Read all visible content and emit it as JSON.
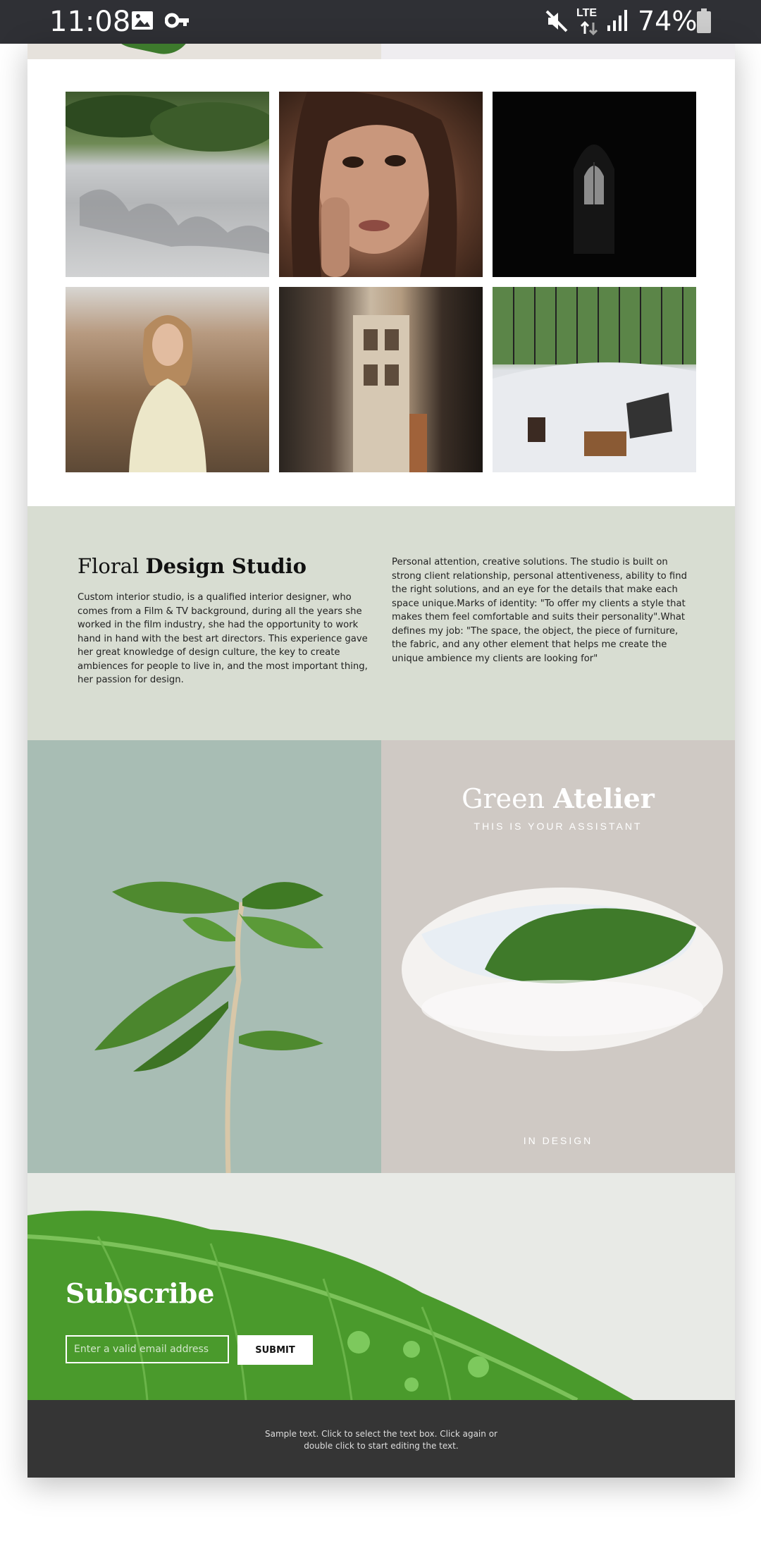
{
  "status_bar": {
    "time": "11:08",
    "network": "LTE",
    "battery": "74%",
    "icons": [
      "image-icon",
      "vpn-key-icon",
      "mute-icon",
      "signal-icon",
      "battery-icon"
    ]
  },
  "gallery": {
    "images": [
      "tree-shadow-photo",
      "woman-face-photo",
      "dark-arch-window-photo",
      "woman-in-field-photo",
      "narrow-street-photo",
      "bed-laptop-photo"
    ]
  },
  "about": {
    "title_light": "Floral ",
    "title_bold": "Design Studio",
    "left_text": "Custom interior studio, is a qualified interior designer, who comes from a Film & TV background, during all the years she worked in the film industry, she had the opportunity to work hand in hand with the best art directors. This experience gave her great knowledge of design culture, the key to create ambiences for people to live in, and the most important thing, her passion for design.",
    "right_text": "Personal attention, creative solutions. The studio is built on strong client relationship, personal attentiveness, ability to find the right solutions, and an eye for the details that make each space unique.Marks of identity: \"To offer my clients a style that makes them feel comfortable and suits their personality\".What defines my job: \"The space, the object, the piece of furniture, the fabric, and any other element that helps me create the unique ambience my clients are looking for\""
  },
  "atelier": {
    "title_light": "Green ",
    "title_bold": "Atelier",
    "subtitle": "THIS IS YOUR ASSISTANT",
    "footer": "IN DESIGN"
  },
  "subscribe": {
    "title": "Subscribe",
    "email_placeholder": "Enter a valid email address",
    "submit_label": "SUBMIT"
  },
  "footer": {
    "text": "Sample text. Click to select the text box. Click again or double click to start editing the text."
  },
  "colors": {
    "status_bar_bg": "#2f3035",
    "about_bg": "#d8ddd2",
    "plant_bg": "#a8bdb4",
    "atelier_bg": "#cfc9c4",
    "footer_bg": "#353535"
  }
}
